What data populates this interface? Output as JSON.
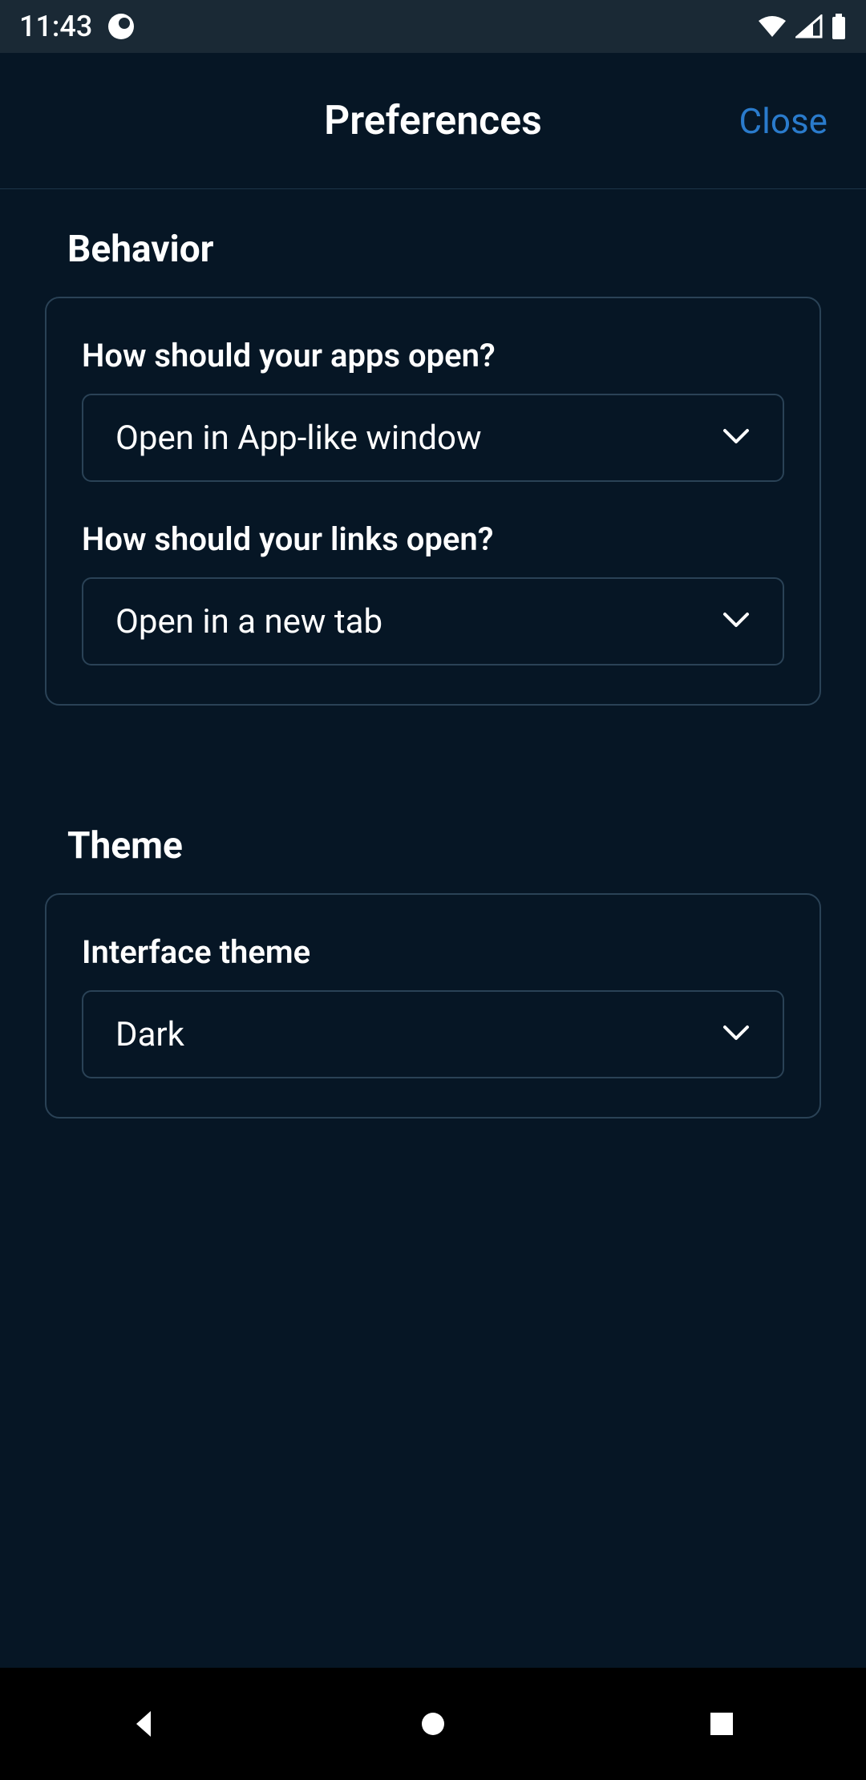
{
  "statusBar": {
    "time": "11:43"
  },
  "header": {
    "title": "Preferences",
    "closeLabel": "Close"
  },
  "sections": {
    "behavior": {
      "title": "Behavior",
      "appsOpen": {
        "label": "How should your apps open?",
        "value": "Open in App-like window"
      },
      "linksOpen": {
        "label": "How should your links open?",
        "value": "Open in a new tab"
      }
    },
    "theme": {
      "title": "Theme",
      "interfaceTheme": {
        "label": "Interface theme",
        "value": "Dark"
      }
    }
  }
}
